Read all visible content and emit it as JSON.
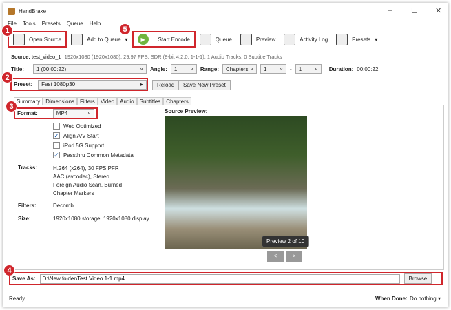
{
  "app": {
    "title": "HandBrake",
    "minimize": "–",
    "maximize": "☐",
    "close": "✕"
  },
  "menu": [
    "File",
    "Tools",
    "Presets",
    "Queue",
    "Help"
  ],
  "toolbar": {
    "open_source": "Open Source",
    "add_to_queue": "Add to Queue",
    "start_encode": "Start Encode",
    "queue": "Queue",
    "preview": "Preview",
    "activity_log": "Activity Log",
    "presets": "Presets"
  },
  "source": {
    "label": "Source:",
    "name": "test_video_1",
    "info": "1920x1080 (1920x1080), 29.97 FPS, SDR (8-bit 4:2:0, 1-1-1), 1 Audio Tracks, 0 Subtitle Tracks"
  },
  "title_row": {
    "title_label": "Title:",
    "title_value": "1 (00:00:22)",
    "angle_label": "Angle:",
    "angle_value": "1",
    "range_label": "Range:",
    "range_value": "Chapters",
    "range_from": "1",
    "dash": "-",
    "range_to": "1",
    "duration_label": "Duration:",
    "duration_value": "00:00:22"
  },
  "preset": {
    "label": "Preset:",
    "value": "Fast 1080p30",
    "reload": "Reload",
    "save_new": "Save New Preset"
  },
  "tabs": [
    "Summary",
    "Dimensions",
    "Filters",
    "Video",
    "Audio",
    "Subtitles",
    "Chapters"
  ],
  "summary": {
    "format_label": "Format:",
    "format_value": "MP4",
    "options": [
      {
        "label": "Web Optimized",
        "checked": false
      },
      {
        "label": "Align A/V Start",
        "checked": true
      },
      {
        "label": "iPod 5G Support",
        "checked": false
      },
      {
        "label": "Passthru Common Metadata",
        "checked": true
      }
    ],
    "tracks_label": "Tracks:",
    "tracks": [
      "H.264 (x264), 30 FPS PFR",
      "AAC (avcodec), Stereo",
      "Foreign Audio Scan, Burned",
      "Chapter Markers"
    ],
    "filters_label": "Filters:",
    "filters_value": "Decomb",
    "size_label": "Size:",
    "size_value": "1920x1080 storage, 1920x1080 display"
  },
  "preview": {
    "label": "Source Preview:",
    "counter": "Preview 2 of 10",
    "prev": "<",
    "next": ">"
  },
  "save": {
    "label": "Save As:",
    "value": "D:\\New folder\\Test Video 1-1.mp4",
    "browse": "Browse"
  },
  "status": {
    "text": "Ready",
    "when_done_label": "When Done:",
    "when_done_value": "Do nothing"
  },
  "badges": [
    "1",
    "2",
    "3",
    "4",
    "5"
  ]
}
